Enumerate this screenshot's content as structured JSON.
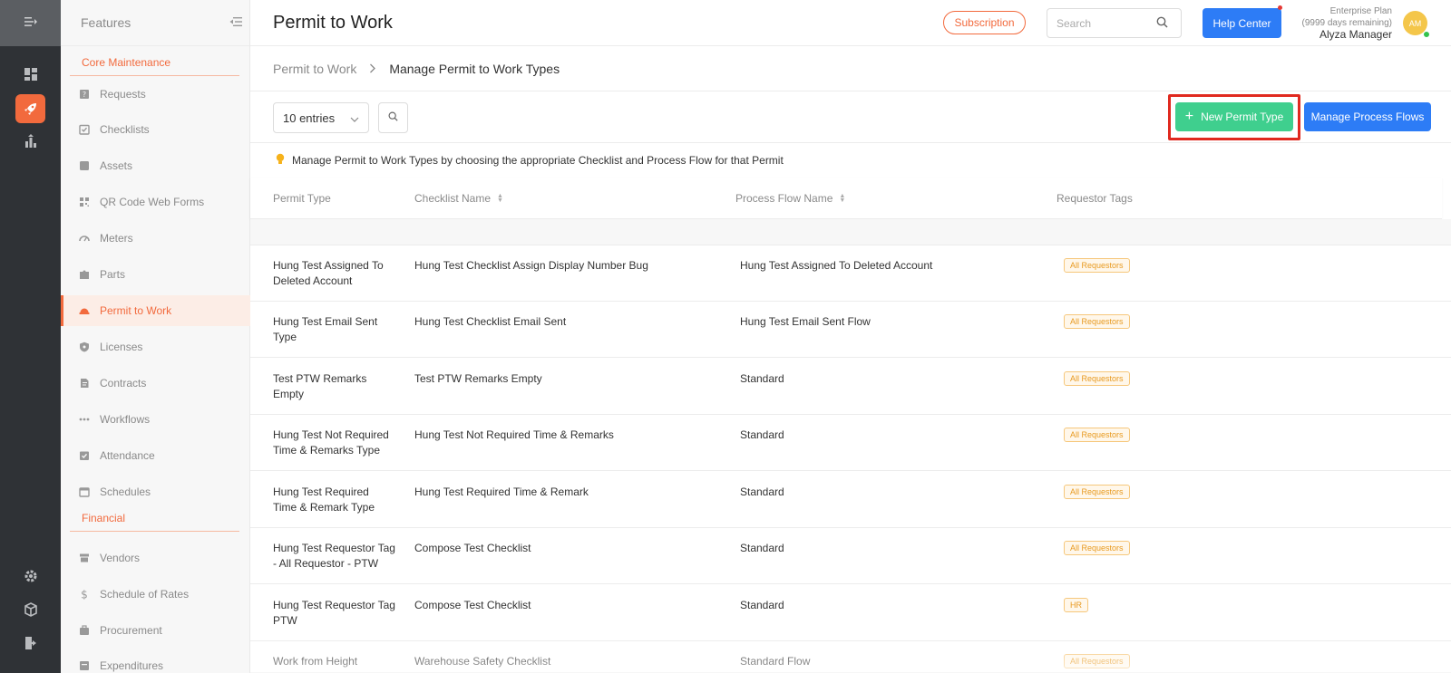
{
  "sidebar": {
    "title": "Features",
    "sections": [
      {
        "label": "Core Maintenance"
      },
      {
        "label": "Financial"
      }
    ],
    "items": [
      {
        "label": "Requests"
      },
      {
        "label": "Checklists"
      },
      {
        "label": "Assets"
      },
      {
        "label": "QR Code Web Forms"
      },
      {
        "label": "Meters"
      },
      {
        "label": "Parts"
      },
      {
        "label": "Permit to Work"
      },
      {
        "label": "Licenses"
      },
      {
        "label": "Contracts"
      },
      {
        "label": "Workflows"
      },
      {
        "label": "Attendance"
      },
      {
        "label": "Schedules"
      },
      {
        "label": "Vendors"
      },
      {
        "label": "Schedule of Rates"
      },
      {
        "label": "Procurement"
      },
      {
        "label": "Expenditures"
      }
    ],
    "active_item": "Permit to Work"
  },
  "header": {
    "title": "Permit to Work",
    "subscription_label": "Subscription",
    "search_placeholder": "Search",
    "help_label": "Help Center",
    "plan_name": "Enterprise Plan",
    "plan_days": "(9999 days remaining)",
    "user_name": "Alyza Manager",
    "user_initials": "AM"
  },
  "breadcrumb": {
    "parent": "Permit to Work",
    "current": "Manage Permit to Work Types"
  },
  "toolbar": {
    "entries_label": "10 entries",
    "new_label": "New Permit Type",
    "flows_label": "Manage Process Flows"
  },
  "info_text": "Manage Permit to Work Types by choosing the appropriate Checklist and Process Flow for that Permit",
  "table": {
    "columns": [
      "Permit Type",
      "Checklist Name",
      "Process Flow Name",
      "Requestor Tags"
    ],
    "rows": [
      {
        "permit": "Hung Test Assigned To Deleted Account",
        "checklist": "Hung Test Checklist Assign Display Number Bug",
        "flow": "Hung Test Assigned To Deleted Account",
        "tag": "All Requestors"
      },
      {
        "permit": "Hung Test Email Sent Type",
        "checklist": "Hung Test Checklist Email Sent",
        "flow": "Hung Test Email Sent Flow",
        "tag": "All Requestors"
      },
      {
        "permit": "Test PTW Remarks Empty",
        "checklist": "Test PTW Remarks Empty",
        "flow": "Standard",
        "tag": "All Requestors"
      },
      {
        "permit": "Hung Test Not Required Time & Remarks Type",
        "checklist": "Hung Test Not Required Time & Remarks",
        "flow": "Standard",
        "tag": "All Requestors"
      },
      {
        "permit": "Hung Test Required Time & Remark Type",
        "checklist": "Hung Test Required Time & Remark",
        "flow": "Standard",
        "tag": "All Requestors"
      },
      {
        "permit": "Hung Test Requestor Tag - All Requestor - PTW",
        "checklist": "Compose Test Checklist",
        "flow": "Standard",
        "tag": "All Requestors"
      },
      {
        "permit": "Hung Test Requestor Tag PTW",
        "checklist": "Compose Test Checklist",
        "flow": "Standard",
        "tag": "HR"
      },
      {
        "permit": "Work from Height",
        "checklist": "Warehouse Safety Checklist",
        "flow": "Standard Flow",
        "tag": "All Requestors"
      }
    ]
  },
  "icons": {
    "rail": [
      "collapse-menu-icon",
      "dashboard-icon",
      "rocket-icon",
      "analytics-icon",
      "gear-icon",
      "box-icon",
      "logout-icon"
    ],
    "accent_color": "#f26a3d",
    "primary_color": "#2d7cf6",
    "success_color": "#3fcf8e"
  }
}
